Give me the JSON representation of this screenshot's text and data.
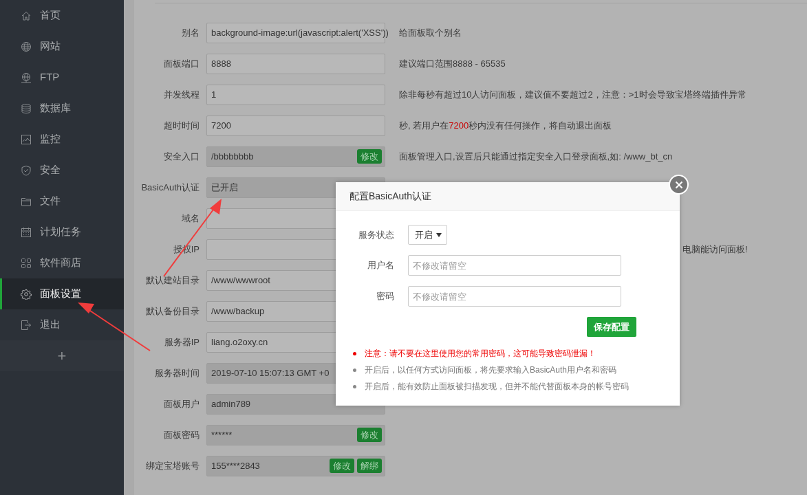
{
  "sidebar": {
    "items": [
      {
        "label": "首页",
        "selected": false
      },
      {
        "label": "网站",
        "selected": false
      },
      {
        "label": "FTP",
        "selected": false
      },
      {
        "label": "数据库",
        "selected": false
      },
      {
        "label": "监控",
        "selected": false
      },
      {
        "label": "安全",
        "selected": false
      },
      {
        "label": "文件",
        "selected": false
      },
      {
        "label": "计划任务",
        "selected": false
      },
      {
        "label": "软件商店",
        "selected": false
      },
      {
        "label": "面板设置",
        "selected": true
      },
      {
        "label": "退出",
        "selected": false
      }
    ],
    "add_button": "+"
  },
  "settings": [
    {
      "label": "别名",
      "value": "background-image:url(javascript:alert('XSS'))",
      "readonly": false,
      "description": [
        {
          "text": "给面板取个别名",
          "highlight": false
        }
      ]
    },
    {
      "label": "面板端口",
      "value": "8888",
      "readonly": false,
      "description": [
        {
          "text": "建议端口范围8888 - 65535",
          "highlight": false
        }
      ]
    },
    {
      "label": "并发线程",
      "value": "1",
      "readonly": false,
      "description": [
        {
          "text": "除非每秒有超过10人访问面板，建议值不要超过2，注意：>1时会导致宝塔终端插件异常",
          "highlight": false
        }
      ]
    },
    {
      "label": "超时时间",
      "value": "7200",
      "readonly": false,
      "description": [
        {
          "text": "秒, 若用户在",
          "highlight": false
        },
        {
          "text": "7200",
          "highlight": true
        },
        {
          "text": "秒内没有任何操作，将自动退出面板",
          "highlight": false
        }
      ]
    },
    {
      "label": "安全入口",
      "value": "/bbbbbbbb",
      "readonly": true,
      "buttons": [
        "修改"
      ],
      "description": [
        {
          "text": "面板管理入口,设置后只能通过指定安全入口登录面板,如: /www_bt_cn",
          "highlight": false
        }
      ]
    },
    {
      "label": "BasicAuth认证",
      "value": "已开启",
      "readonly": true
    },
    {
      "label": "域名",
      "readonly": false
    },
    {
      "label": "授权IP",
      "readonly": false,
      "description": [
        {
          "text": "电脑能访问面板!",
          "highlight": false
        }
      ],
      "description_clipped": true
    },
    {
      "label": "默认建站目录",
      "value": "/www/wwwroot",
      "readonly": false
    },
    {
      "label": "默认备份目录",
      "value": "/www/backup",
      "readonly": false
    },
    {
      "label": "服务器IP",
      "value": "liang.o2oxy.cn",
      "readonly": false
    },
    {
      "label": "服务器时间",
      "value": "2019-07-10 15:07:13 GMT +0",
      "readonly": true
    },
    {
      "label": "面板用户",
      "value": "admin789",
      "readonly": true
    },
    {
      "label": "面板密码",
      "value": "******",
      "readonly": true,
      "buttons": [
        "修改"
      ]
    },
    {
      "label": "绑定宝塔账号",
      "value": "155****2843",
      "readonly": true,
      "buttons": [
        "修改",
        "解绑"
      ]
    }
  ],
  "modal": {
    "title": "配置BasicAuth认证",
    "fields": [
      {
        "kind": "select",
        "label": "服务状态",
        "value": "开启"
      },
      {
        "kind": "input",
        "label": "用户名",
        "placeholder": "不修改请留空"
      },
      {
        "kind": "input",
        "label": "密码",
        "placeholder": "不修改请留空"
      }
    ],
    "save_button": "保存配置",
    "notes": [
      {
        "text": "注意：请不要在这里使用您的常用密码，这可能导致密码泄漏！",
        "warning": true
      },
      {
        "text": "开启后，以任何方式访问面板，将先要求输入BasicAuth用户名和密码",
        "warning": false
      },
      {
        "text": "开启后，能有效防止面板被扫描发现，但并不能代替面板本身的帐号密码",
        "warning": false
      }
    ]
  }
}
